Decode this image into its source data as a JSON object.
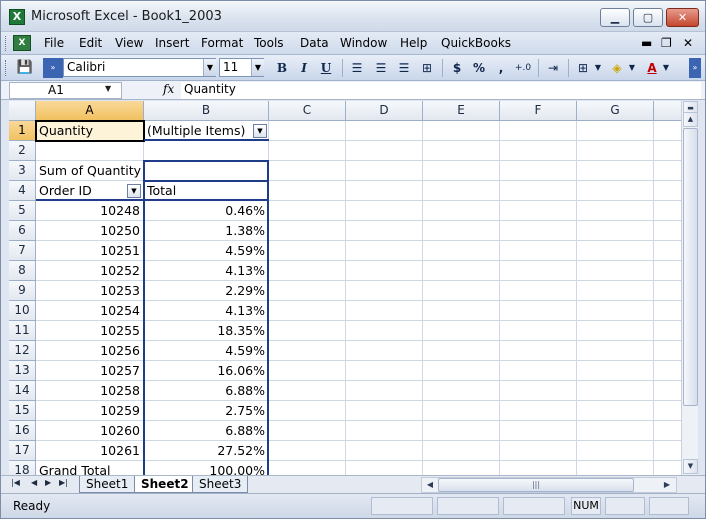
{
  "window": {
    "title": "Microsoft Excel - Book1_2003"
  },
  "menu": {
    "items": [
      "File",
      "Edit",
      "View",
      "Insert",
      "Format",
      "Tools",
      "Data",
      "Window",
      "Help",
      "QuickBooks"
    ]
  },
  "toolbar": {
    "font_name": "Calibri",
    "font_size": "11",
    "bold": "B",
    "italic": "I",
    "underline": "U",
    "currency": "$",
    "percent": "%",
    "comma": ","
  },
  "formula_bar": {
    "name_box": "A1",
    "fx": "fx",
    "formula": "Quantity"
  },
  "grid": {
    "columns": [
      "A",
      "B",
      "C",
      "D",
      "E",
      "F",
      "G"
    ],
    "rows": [
      {
        "n": "1",
        "a": "Quantity",
        "b": "(Multiple Items)"
      },
      {
        "n": "2",
        "a": "",
        "b": ""
      },
      {
        "n": "3",
        "a": "Sum of Quantity",
        "b": ""
      },
      {
        "n": "4",
        "a": "Order ID",
        "b": "Total"
      },
      {
        "n": "5",
        "a": "10248",
        "b": "0.46%"
      },
      {
        "n": "6",
        "a": "10250",
        "b": "1.38%"
      },
      {
        "n": "7",
        "a": "10251",
        "b": "4.59%"
      },
      {
        "n": "8",
        "a": "10252",
        "b": "4.13%"
      },
      {
        "n": "9",
        "a": "10253",
        "b": "2.29%"
      },
      {
        "n": "10",
        "a": "10254",
        "b": "4.13%"
      },
      {
        "n": "11",
        "a": "10255",
        "b": "18.35%"
      },
      {
        "n": "12",
        "a": "10256",
        "b": "4.59%"
      },
      {
        "n": "13",
        "a": "10257",
        "b": "16.06%"
      },
      {
        "n": "14",
        "a": "10258",
        "b": "6.88%"
      },
      {
        "n": "15",
        "a": "10259",
        "b": "2.75%"
      },
      {
        "n": "16",
        "a": "10260",
        "b": "6.88%"
      },
      {
        "n": "17",
        "a": "10261",
        "b": "27.52%"
      },
      {
        "n": "18",
        "a": "Grand Total",
        "b": "100.00%"
      }
    ]
  },
  "sheets": {
    "tabs": [
      "Sheet1",
      "Sheet2",
      "Sheet3"
    ],
    "active": "Sheet2"
  },
  "status": {
    "text": "Ready",
    "num": "NUM"
  },
  "colors": {
    "pivot_border": "#1f3c8a",
    "active_header": "#f1c15f",
    "gridline": "#d0d7e5"
  }
}
